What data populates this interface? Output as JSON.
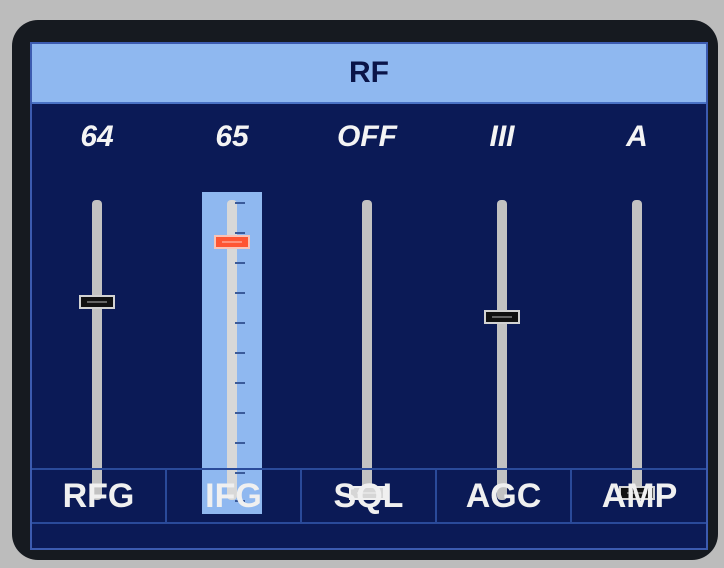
{
  "screen": {
    "title": "RF"
  },
  "channels": [
    {
      "label": "RFG",
      "value": "64",
      "level": 0.66,
      "selected": false
    },
    {
      "label": "IFG",
      "value": "65",
      "level": 0.86,
      "selected": true
    },
    {
      "label": "SQL",
      "value": "OFF",
      "level": 0.0,
      "selected": false
    },
    {
      "label": "AGC",
      "value": "III",
      "level": 0.61,
      "selected": false
    },
    {
      "label": "AMP",
      "value": "A",
      "level": 0.0,
      "selected": false
    }
  ],
  "colors": {
    "screen_bg": "#0b1a56",
    "title_bar": "#8fb8f0",
    "selected_highlight": "#8fb8f0",
    "active_knob": "#ff5533"
  }
}
